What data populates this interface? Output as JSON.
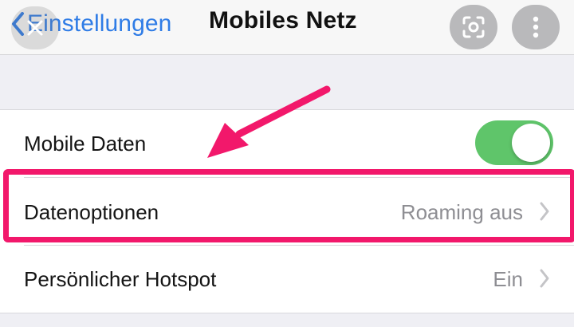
{
  "navbar": {
    "back_label": "Einstellungen",
    "title": "Mobiles Netz",
    "icons": {
      "back": "chevron-left-icon",
      "close": "close-icon",
      "lens": "lens-scan-icon",
      "more": "more-vertical-icon"
    }
  },
  "settings": {
    "rows": [
      {
        "label": "Mobile Daten",
        "value": "",
        "toggle_on": true
      },
      {
        "label": "Datenoptionen",
        "value": "Roaming aus"
      },
      {
        "label": "Persönlicher Hotspot",
        "value": "Ein"
      }
    ]
  },
  "colors": {
    "accent": "#2f7ce6",
    "toggle_on": "#5fc56a",
    "highlight": "#f2186b"
  }
}
